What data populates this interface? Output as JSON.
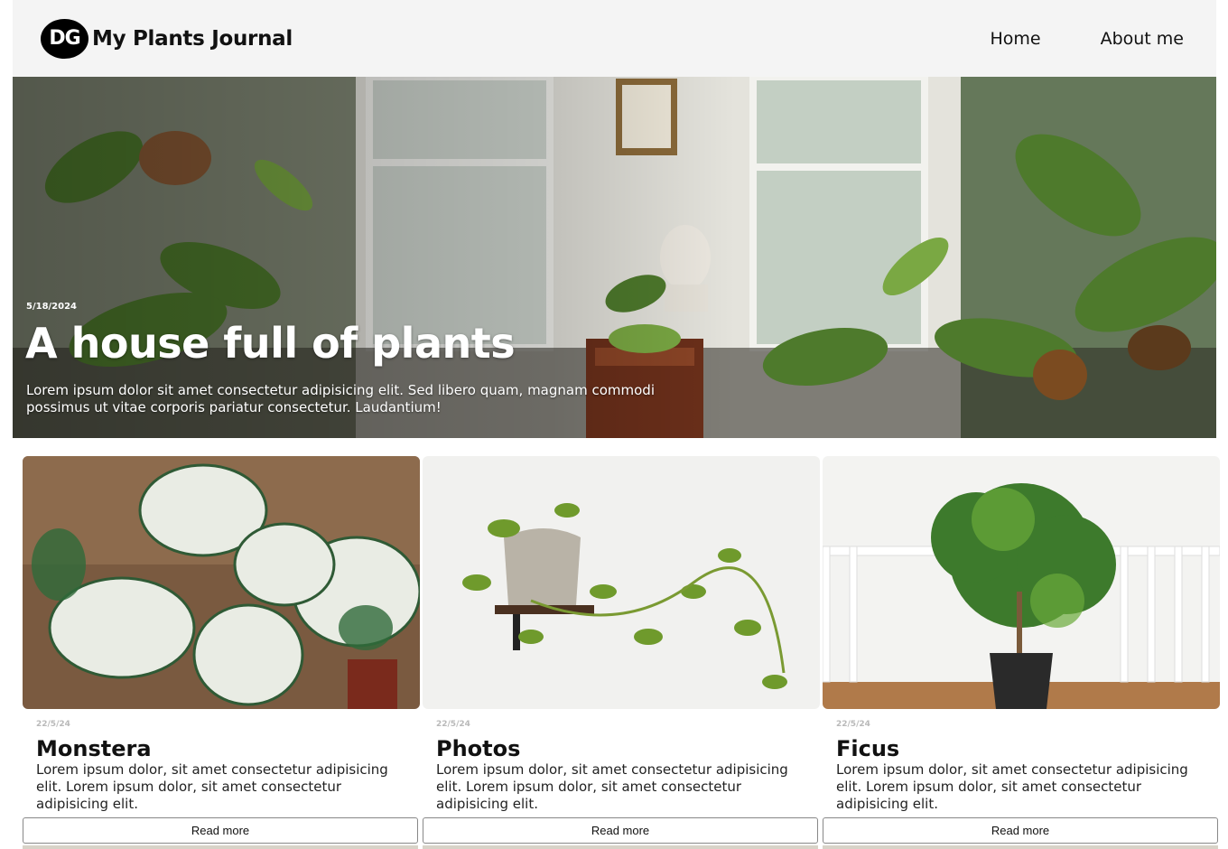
{
  "header": {
    "logo_text": "DG",
    "site_title": "My Plants Journal",
    "nav": [
      {
        "label": "Home"
      },
      {
        "label": "About me"
      }
    ]
  },
  "hero": {
    "date": "5/18/2024",
    "title": "A house full of plants",
    "text": "Lorem ipsum dolor sit amet consectetur adipisicing elit. Sed libero quam, magnam commodi possimus ut vitae corporis pariatur consectetur. Laudantium!"
  },
  "cards": [
    {
      "date": "22/5/24",
      "title": "Monstera",
      "text": "Lorem ipsum dolor, sit amet consectetur adipisicing elit. Lorem ipsum dolor, sit amet consectetur adipisicing elit.",
      "button": "Read more"
    },
    {
      "date": "22/5/24",
      "title": "Photos",
      "text": "Lorem ipsum dolor, sit amet consectetur adipisicing elit. Lorem ipsum dolor, sit amet consectetur adipisicing elit.",
      "button": "Read more"
    },
    {
      "date": "22/5/24",
      "title": "Ficus",
      "text": "Lorem ipsum dolor, sit amet consectetur adipisicing elit. Lorem ipsum dolor, sit amet consectetur adipisicing elit.",
      "button": "Read more"
    }
  ]
}
